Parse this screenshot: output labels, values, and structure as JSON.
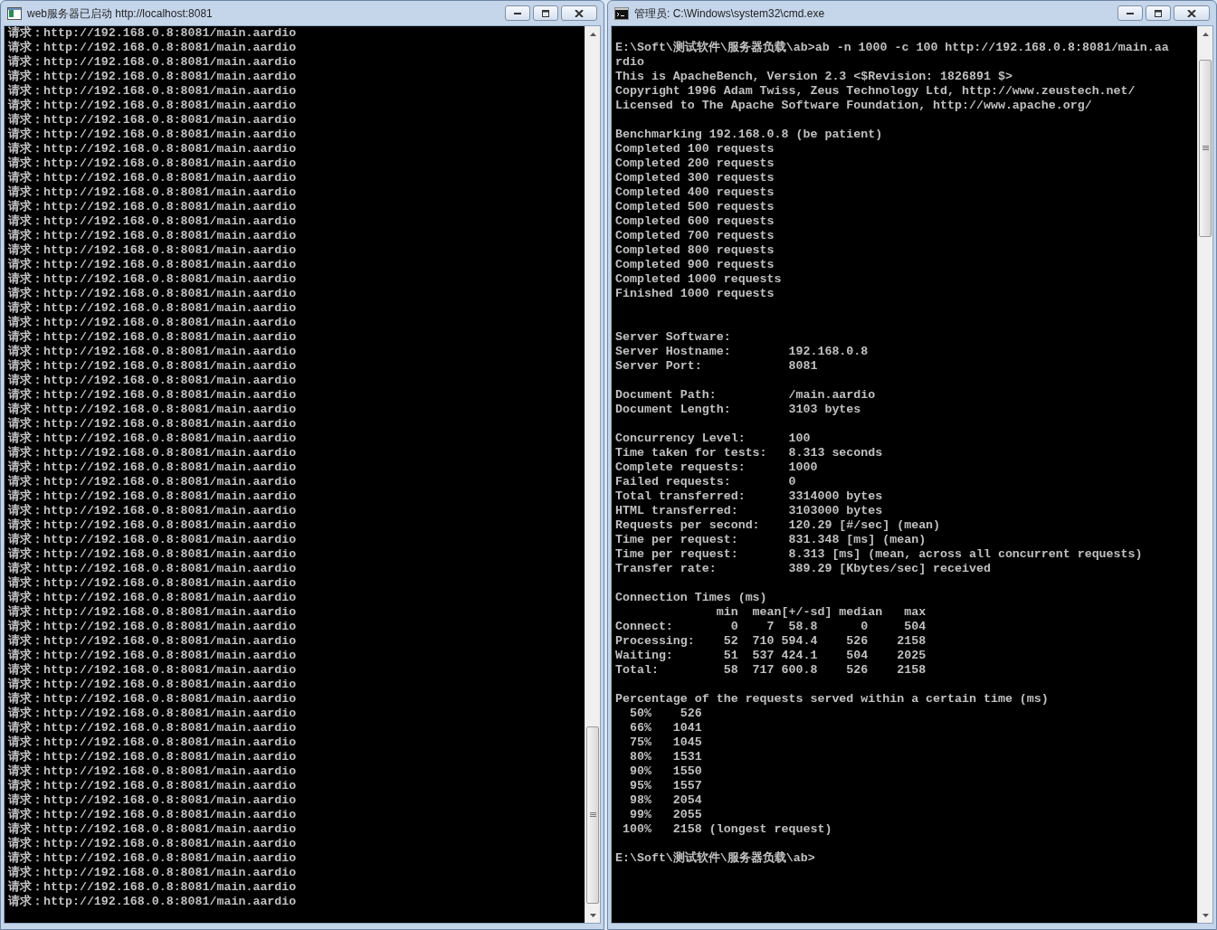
{
  "windows": [
    {
      "kind": "server",
      "title": "web服务器已启动 http://localhost:8081",
      "lines": [
        "请求：http://192.168.0.8:8081/main.aardio",
        "请求：http://192.168.0.8:8081/main.aardio",
        "请求：http://192.168.0.8:8081/main.aardio",
        "请求：http://192.168.0.8:8081/main.aardio",
        "请求：http://192.168.0.8:8081/main.aardio",
        "请求：http://192.168.0.8:8081/main.aardio",
        "请求：http://192.168.0.8:8081/main.aardio",
        "请求：http://192.168.0.8:8081/main.aardio",
        "请求：http://192.168.0.8:8081/main.aardio",
        "请求：http://192.168.0.8:8081/main.aardio",
        "请求：http://192.168.0.8:8081/main.aardio",
        "请求：http://192.168.0.8:8081/main.aardio",
        "请求：http://192.168.0.8:8081/main.aardio",
        "请求：http://192.168.0.8:8081/main.aardio",
        "请求：http://192.168.0.8:8081/main.aardio",
        "请求：http://192.168.0.8:8081/main.aardio",
        "请求：http://192.168.0.8:8081/main.aardio",
        "请求：http://192.168.0.8:8081/main.aardio",
        "请求：http://192.168.0.8:8081/main.aardio",
        "请求：http://192.168.0.8:8081/main.aardio",
        "请求：http://192.168.0.8:8081/main.aardio",
        "请求：http://192.168.0.8:8081/main.aardio",
        "请求：http://192.168.0.8:8081/main.aardio",
        "请求：http://192.168.0.8:8081/main.aardio",
        "请求：http://192.168.0.8:8081/main.aardio",
        "请求：http://192.168.0.8:8081/main.aardio",
        "请求：http://192.168.0.8:8081/main.aardio",
        "请求：http://192.168.0.8:8081/main.aardio",
        "请求：http://192.168.0.8:8081/main.aardio",
        "请求：http://192.168.0.8:8081/main.aardio",
        "请求：http://192.168.0.8:8081/main.aardio",
        "请求：http://192.168.0.8:8081/main.aardio",
        "请求：http://192.168.0.8:8081/main.aardio",
        "请求：http://192.168.0.8:8081/main.aardio",
        "请求：http://192.168.0.8:8081/main.aardio",
        "请求：http://192.168.0.8:8081/main.aardio",
        "请求：http://192.168.0.8:8081/main.aardio",
        "请求：http://192.168.0.8:8081/main.aardio",
        "请求：http://192.168.0.8:8081/main.aardio",
        "请求：http://192.168.0.8:8081/main.aardio",
        "请求：http://192.168.0.8:8081/main.aardio",
        "请求：http://192.168.0.8:8081/main.aardio",
        "请求：http://192.168.0.8:8081/main.aardio",
        "请求：http://192.168.0.8:8081/main.aardio",
        "请求：http://192.168.0.8:8081/main.aardio",
        "请求：http://192.168.0.8:8081/main.aardio",
        "请求：http://192.168.0.8:8081/main.aardio",
        "请求：http://192.168.0.8:8081/main.aardio",
        "请求：http://192.168.0.8:8081/main.aardio",
        "请求：http://192.168.0.8:8081/main.aardio",
        "请求：http://192.168.0.8:8081/main.aardio",
        "请求：http://192.168.0.8:8081/main.aardio",
        "请求：http://192.168.0.8:8081/main.aardio",
        "请求：http://192.168.0.8:8081/main.aardio",
        "请求：http://192.168.0.8:8081/main.aardio",
        "请求：http://192.168.0.8:8081/main.aardio",
        "请求：http://192.168.0.8:8081/main.aardio",
        "请求：http://192.168.0.8:8081/main.aardio",
        "请求：http://192.168.0.8:8081/main.aardio",
        "请求：http://192.168.0.8:8081/main.aardio",
        "请求：http://192.168.0.8:8081/main.aardio"
      ]
    },
    {
      "kind": "cmd",
      "title": "管理员: C:\\Windows\\system32\\cmd.exe",
      "blocks": [
        {
          "kind": "spaced",
          "lines": [
            "E:\\Soft\\测试软件\\服务器负载\\ab>ab -n 1000 -c 100 http://192.168.0.8:8081/main.aa",
            "rdio",
            "This is ApacheBench, Version 2.3 <$Revision: 1826891 $>",
            "Copyright 1996 Adam Twiss, Zeus Technology Ltd, http://www.zeustech.net/",
            "Licensed to The Apache Software Foundation, http://www.apache.org/"
          ]
        },
        {
          "kind": "spaced",
          "lines": [
            "Benchmarking 192.168.0.8 (be patient)",
            "Completed 100 requests",
            "Completed 200 requests",
            "Completed 300 requests",
            "Completed 400 requests",
            "Completed 500 requests",
            "Completed 600 requests",
            "Completed 700 requests",
            "Completed 800 requests",
            "Completed 900 requests",
            "Completed 1000 requests",
            "Finished 1000 requests"
          ]
        },
        {
          "kind": "doublespaced",
          "lines": [
            "Server Software:",
            "Server Hostname:        192.168.0.8",
            "Server Port:            8081"
          ]
        },
        {
          "kind": "spaced",
          "lines": [
            "Document Path:          /main.aardio",
            "Document Length:        3103 bytes"
          ]
        },
        {
          "kind": "spaced",
          "lines": [
            "Concurrency Level:      100",
            "Time taken for tests:   8.313 seconds",
            "Complete requests:      1000",
            "Failed requests:        0",
            "Total transferred:      3314000 bytes",
            "HTML transferred:       3103000 bytes",
            "Requests per second:    120.29 [#/sec] (mean)",
            "Time per request:       831.348 [ms] (mean)",
            "Time per request:       8.313 [ms] (mean, across all concurrent requests)",
            "Transfer rate:          389.29 [Kbytes/sec] received"
          ]
        },
        {
          "kind": "spaced",
          "lines": [
            "Connection Times (ms)",
            "              min  mean[+/-sd] median   max",
            "Connect:        0    7  58.8      0     504",
            "Processing:    52  710 594.4    526    2158",
            "Waiting:       51  537 424.1    504    2025",
            "Total:         58  717 600.8    526    2158"
          ]
        },
        {
          "kind": "spaced",
          "lines": [
            "Percentage of the requests served within a certain time (ms)",
            "  50%    526",
            "  66%   1041",
            "  75%   1045",
            "  80%   1531",
            "  90%   1550",
            "  95%   1557",
            "  98%   2054",
            "  99%   2055",
            " 100%   2158 (longest request)"
          ]
        },
        {
          "kind": "spaced",
          "lines": [
            "E:\\Soft\\测试软件\\服务器负载\\ab>"
          ]
        }
      ]
    }
  ]
}
